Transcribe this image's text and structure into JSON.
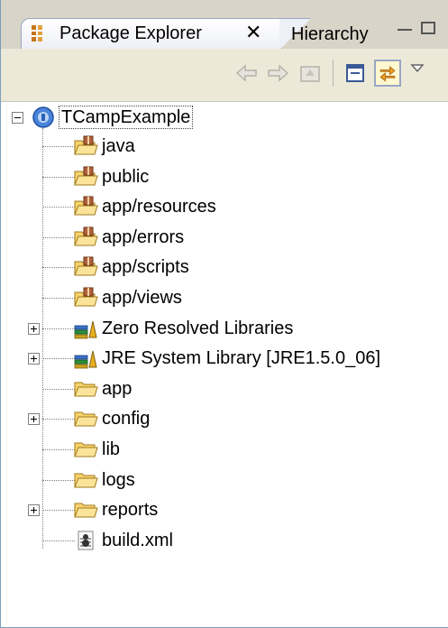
{
  "tabs": {
    "active_label": "Package Explorer",
    "close_glyph": "✕",
    "inactive_label": "Hierarchy"
  },
  "toolbar": {
    "icons": [
      "back-icon",
      "forward-icon",
      "up-icon",
      "collapse-all-icon",
      "link-with-editor-icon",
      "view-menu-icon"
    ]
  },
  "tree": {
    "root": {
      "label": "TCampExample",
      "icon": "project-icon",
      "expanded": true
    },
    "items": [
      {
        "label": "java",
        "icon": "package-folder-icon",
        "expandable": false
      },
      {
        "label": "public",
        "icon": "package-folder-icon",
        "expandable": false
      },
      {
        "label": "app/resources",
        "icon": "package-folder-icon",
        "expandable": false
      },
      {
        "label": "app/errors",
        "icon": "package-folder-icon",
        "expandable": false
      },
      {
        "label": "app/scripts",
        "icon": "package-folder-icon",
        "expandable": false
      },
      {
        "label": "app/views",
        "icon": "package-folder-icon",
        "expandable": false
      },
      {
        "label": "Zero Resolved Libraries",
        "icon": "library-icon",
        "expandable": true
      },
      {
        "label": "JRE System Library [JRE1.5.0_06]",
        "icon": "library-icon",
        "expandable": true
      },
      {
        "label": "app",
        "icon": "folder-icon",
        "expandable": false
      },
      {
        "label": "config",
        "icon": "folder-icon",
        "expandable": true
      },
      {
        "label": "lib",
        "icon": "folder-icon",
        "expandable": false
      },
      {
        "label": "logs",
        "icon": "folder-icon",
        "expandable": false
      },
      {
        "label": "reports",
        "icon": "folder-icon",
        "expandable": true
      },
      {
        "label": "build.xml",
        "icon": "ant-file-icon",
        "expandable": false
      }
    ]
  },
  "colors": {
    "tab_strip": "#d8d4c8",
    "toolbar": "#ece9d8",
    "folder": "#f6d36b",
    "library_stack": "#2a8f3a"
  }
}
